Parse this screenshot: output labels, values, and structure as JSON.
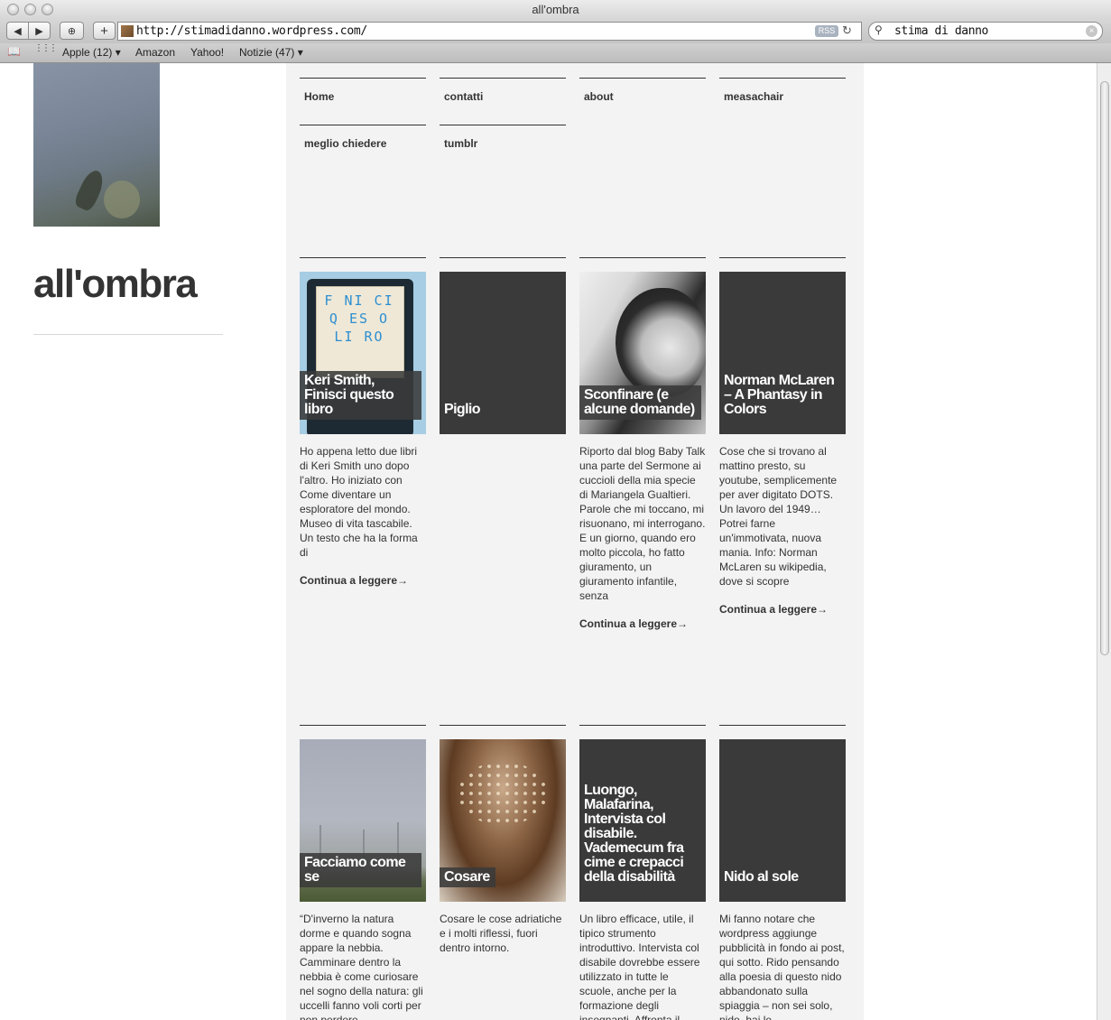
{
  "window": {
    "title": "all'ombra"
  },
  "toolbar": {
    "back_label": "◀",
    "forward_label": "▶",
    "bookmark_label": "⊕",
    "add_label": "+",
    "url": "http://stimadidanno.wordpress.com/",
    "rss_label": "RSS",
    "reload_label": "↻",
    "search_value": "stima di danno"
  },
  "bookmarks": {
    "book_icon": "📖",
    "grid_icon": "⋮⋮⋮",
    "items": [
      "Apple (12) ▾",
      "Amazon",
      "Yahoo!",
      "Notizie (47) ▾"
    ]
  },
  "site": {
    "title": "all'ombra"
  },
  "nav": [
    "Home",
    "contatti",
    "about",
    "measachair",
    "meglio chiedere",
    "tumblr"
  ],
  "posts": [
    {
      "title": "Keri Smith, Finisci questo libro",
      "excerpt": "Ho appena letto due libri di Keri Smith uno dopo l'altro. Ho iniziato con Come diventare un esploratore del mondo. Museo di vita tascabile. Un testo che ha la forma di",
      "more": "Continua a leggere→",
      "image_text": "F NI CI Q ES O LI RO"
    },
    {
      "title": "Piglio",
      "excerpt": "",
      "more": ""
    },
    {
      "title": "Sconfinare (e alcune domande)",
      "excerpt": "Riporto dal blog Baby Talk una parte del Sermone ai cuccioli della mia specie di Mariangela Gualtieri. Parole che mi toccano, mi risuonano, mi interrogano. E un giorno, quando ero molto piccola, ho fatto giuramento, un giuramento infantile, senza",
      "more": "Continua a leggere→"
    },
    {
      "title": "Norman McLaren – A Phantasy in Colors",
      "excerpt": "Cose che si trovano al mattino presto, su youtube, semplicemente per aver digitato DOTS. Un lavoro del 1949… Potrei farne un'immotivata, nuova mania. Info: Norman McLaren su wikipedia, dove si scopre",
      "more": "Continua a leggere→"
    },
    {
      "title": "Facciamo come se",
      "excerpt": "“D'inverno la natura dorme e quando sogna appare la nebbia. Camminare dentro la nebbia è come curiosare nel sogno della natura: gli uccelli fanno voli corti per non perdere",
      "more": ""
    },
    {
      "title": "Cosare",
      "excerpt": "Cosare le cose adriatiche e i molti riflessi, fuori dentro intorno.",
      "more": ""
    },
    {
      "title": "Luongo, Malafarina, Intervista col disabile. Vademecum fra cime e crepacci della disabilità",
      "excerpt": "Un libro efficace, utile, il tipico strumento introduttivo. Intervista col disabile dovrebbe essere utilizzato in tutte le scuole, anche per la formazione degli insegnanti. Affronta il",
      "more": ""
    },
    {
      "title": "Nido al sole",
      "excerpt": "Mi fanno notare che wordpress aggiunge pubblicità in fondo ai post, qui sotto. Rido pensando alla poesia di questo nido abbandonato sulla spiaggia – non sei solo, nido, hai le",
      "more": ""
    }
  ]
}
